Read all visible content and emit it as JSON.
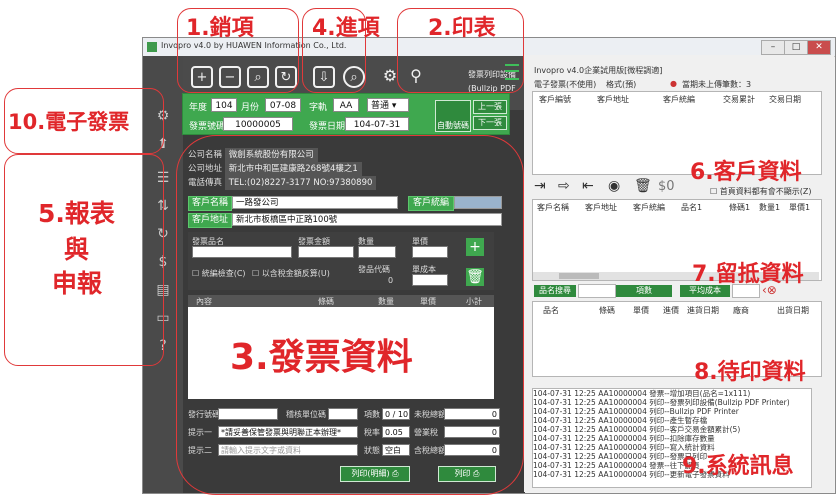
{
  "window": {
    "title": "Invopro v4.0 by HUAWEN Information Co., Ltd."
  },
  "toolbar": {
    "printer_line1": "發票列印設備",
    "printer_line2": "(Bullzip PDF Printer)"
  },
  "datebar": {
    "year_label": "年度",
    "year": "104",
    "month_label": "月份",
    "month": "07-08",
    "track_label": "字軌",
    "track": "AA",
    "track_type": "普通",
    "inv_no_label": "發票號碼",
    "inv_no": "10000005",
    "inv_date_label": "發票日期",
    "inv_date": "104-07-31",
    "auto_btn": "自動號碼",
    "prev_btn": "上一張",
    "next_btn": "下一張"
  },
  "company": {
    "name_label": "公司名稱",
    "name": "微創系統股份有限公司",
    "addr_label": "公司地址",
    "addr": "新北市中和區建康路268號4樓之1",
    "tel_label": "電話傳真",
    "tel": "TEL:(02)8227-3177 NO:97380890"
  },
  "customer": {
    "name_label": "客戶名稱",
    "name": "一路發公司",
    "id_label": "客戶統編",
    "addr_label": "客戶地址",
    "addr": "新北市板橋區中正路100號"
  },
  "item": {
    "name_label": "發票品名",
    "price_label": "發票金額",
    "qty_label": "數量",
    "unit_label": "單價",
    "code_label": "發品代碼",
    "code": "0",
    "cost_label": "單成本",
    "chk1": "統編檢查(C)",
    "chk2": "以含稅金額反算(U)"
  },
  "table": {
    "cols": [
      "內容",
      "條碼",
      "數量",
      "單價",
      "小計"
    ]
  },
  "bottom": {
    "remark_label": "發行號碼",
    "remark2_label": "稽核單位碼",
    "count_label": "項數",
    "count": "0 / 10",
    "untaxed_label": "未稅總額",
    "untaxed": "0",
    "note1_label": "提示一",
    "note1": "*請妥善保管發票與明聯正本辦理*",
    "tax_label": "稅率",
    "tax": "0.05",
    "tax_amt_label": "營業稅",
    "tax_amt": "0",
    "note2_label": "提示二",
    "note2": "請輸入提示文字或資料",
    "eff_label": "狀態",
    "eff": "空白",
    "total_label": "含稅總額",
    "total": "0",
    "print_detail_btn": "列印(明細)",
    "print_btn": "列印"
  },
  "right": {
    "title": "Invopro v4.0企業試用版[微程調適]",
    "sub1": "電子發票(不使用)",
    "sub2": "格式(預)",
    "warn": "當期未上傳筆數：3",
    "c_cols": [
      "客戶編號",
      "客戶地址",
      "客戶統編",
      "交易累計",
      "交易日期"
    ],
    "money_sym": "$0",
    "chk_text": "首頁資料都有會不顯示(Z)",
    "r_cols": [
      "客戶名稱",
      "客戶地址",
      "客戶統編",
      "品名1",
      "條碼1",
      "數量1",
      "單價1"
    ],
    "btn_a": "品名搜尋",
    "btn_b": "項數",
    "btn_c": "平均成本",
    "p_cols": [
      "品名",
      "條碼",
      "單價",
      "進價",
      "進貨日期",
      "廠商",
      "出貨日期"
    ],
    "log": [
      "104-07-31 12:25 AA10000004 發票--增加項目(品名=1x111)",
      "104-07-31 12:25 AA10000004 列印--發票列印設備(Bullzip PDF Printer)",
      "104-07-31 12:25 AA10000004 列印--Bullzip PDF Printer",
      "104-07-31 12:25 AA10000004 列印--產生暫存檔",
      "104-07-31 12:25 AA10000004 列印--客戶交易金額累計(5)",
      "104-07-31 12:25 AA10000004 列印--扣除庫存數量",
      "104-07-31 12:25 AA10000004 列印--寫入統計資料",
      "104-07-31 12:25 AA10000004 列印--發票已列印",
      "104-07-31 12:25 AA10000004 發票--往下翻頁",
      "104-07-31 12:25 AA10000004 列印--更新電子發票資料"
    ]
  },
  "annotations": {
    "a1": "1.銷項",
    "a2": "2.印表",
    "a3": "3.發票資料",
    "a4": "4.進項",
    "a5_1": "5.報表",
    "a5_2": "與",
    "a5_3": "申報",
    "a6": "6.客戶資料",
    "a7": "7.留抵資料",
    "a8": "8.待印資料",
    "a9": "9.系統訊息",
    "a10": "10.電子發票"
  }
}
